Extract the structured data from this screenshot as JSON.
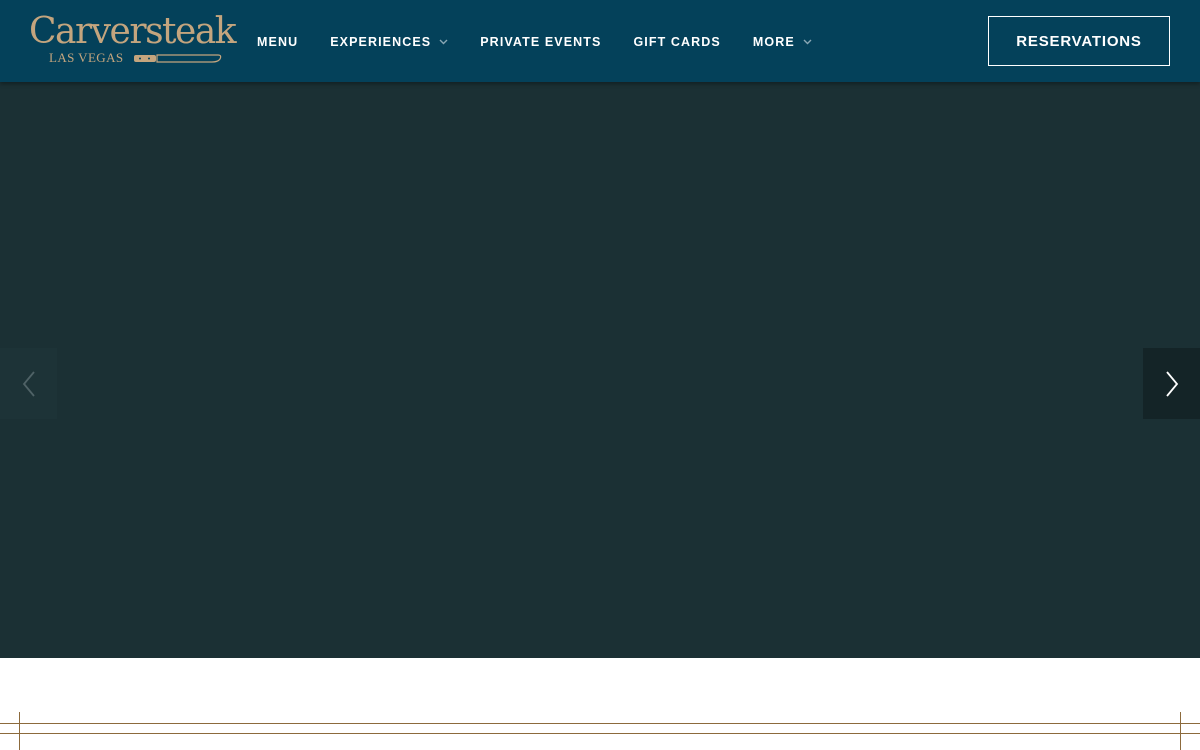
{
  "brand": {
    "logo_text": "Carversteak",
    "logo_subtext": "LAS VEGAS"
  },
  "nav": {
    "items": [
      {
        "label": "MENU",
        "has_dropdown": false
      },
      {
        "label": "EXPERIENCES",
        "has_dropdown": true
      },
      {
        "label": "PRIVATE EVENTS",
        "has_dropdown": false
      },
      {
        "label": "GIFT CARDS",
        "has_dropdown": false
      },
      {
        "label": "MORE",
        "has_dropdown": true
      }
    ]
  },
  "cta": {
    "reservations_label": "RESERVATIONS"
  },
  "slider": {
    "prev_icon": "chevron-left-icon",
    "next_icon": "chevron-right-icon"
  },
  "colors": {
    "header_bg": "#04415a",
    "logo_gold": "#c4a57e",
    "hero_bg": "#1b3034",
    "frame_line": "#8c6a3c",
    "nav_text": "#ffffff"
  }
}
